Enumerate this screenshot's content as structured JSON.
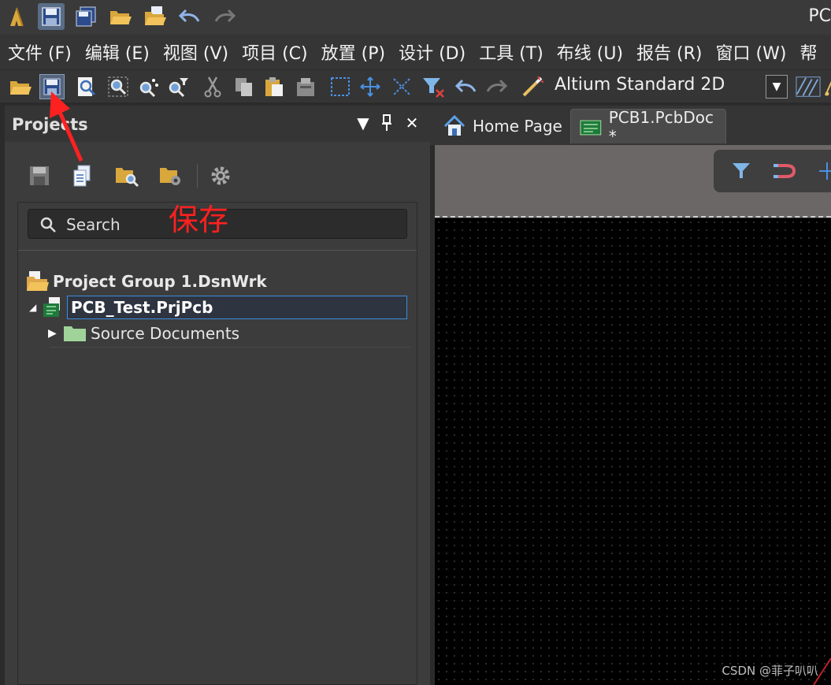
{
  "app": {
    "title": "PC"
  },
  "menu": [
    {
      "label": "文件 (F)"
    },
    {
      "label": "编辑 (E)"
    },
    {
      "label": "视图 (V)"
    },
    {
      "label": "项目 (C)"
    },
    {
      "label": "放置 (P)"
    },
    {
      "label": "设计 (D)"
    },
    {
      "label": "工具 (T)"
    },
    {
      "label": "布线 (U)"
    },
    {
      "label": "报告 (R)"
    },
    {
      "label": "窗口 (W)"
    },
    {
      "label": "帮"
    }
  ],
  "toolbar": {
    "view_mode": "Altium Standard 2D"
  },
  "projects_panel": {
    "title": "Projects",
    "search_placeholder": "Search",
    "annotation": "保存",
    "tree": [
      {
        "label": "Project Group 1.DsnWrk"
      },
      {
        "label": "PCB_Test.PrjPcb"
      },
      {
        "label": "Source Documents"
      }
    ]
  },
  "tabs": [
    {
      "label": "Home Page"
    },
    {
      "label": "PCB1.PcbDoc *"
    }
  ],
  "watermark": "CSDN @菲子叭叭",
  "colors": {
    "accent": "#3c8dde",
    "annotation": "#ff2020",
    "folder": "#9fd39a"
  }
}
